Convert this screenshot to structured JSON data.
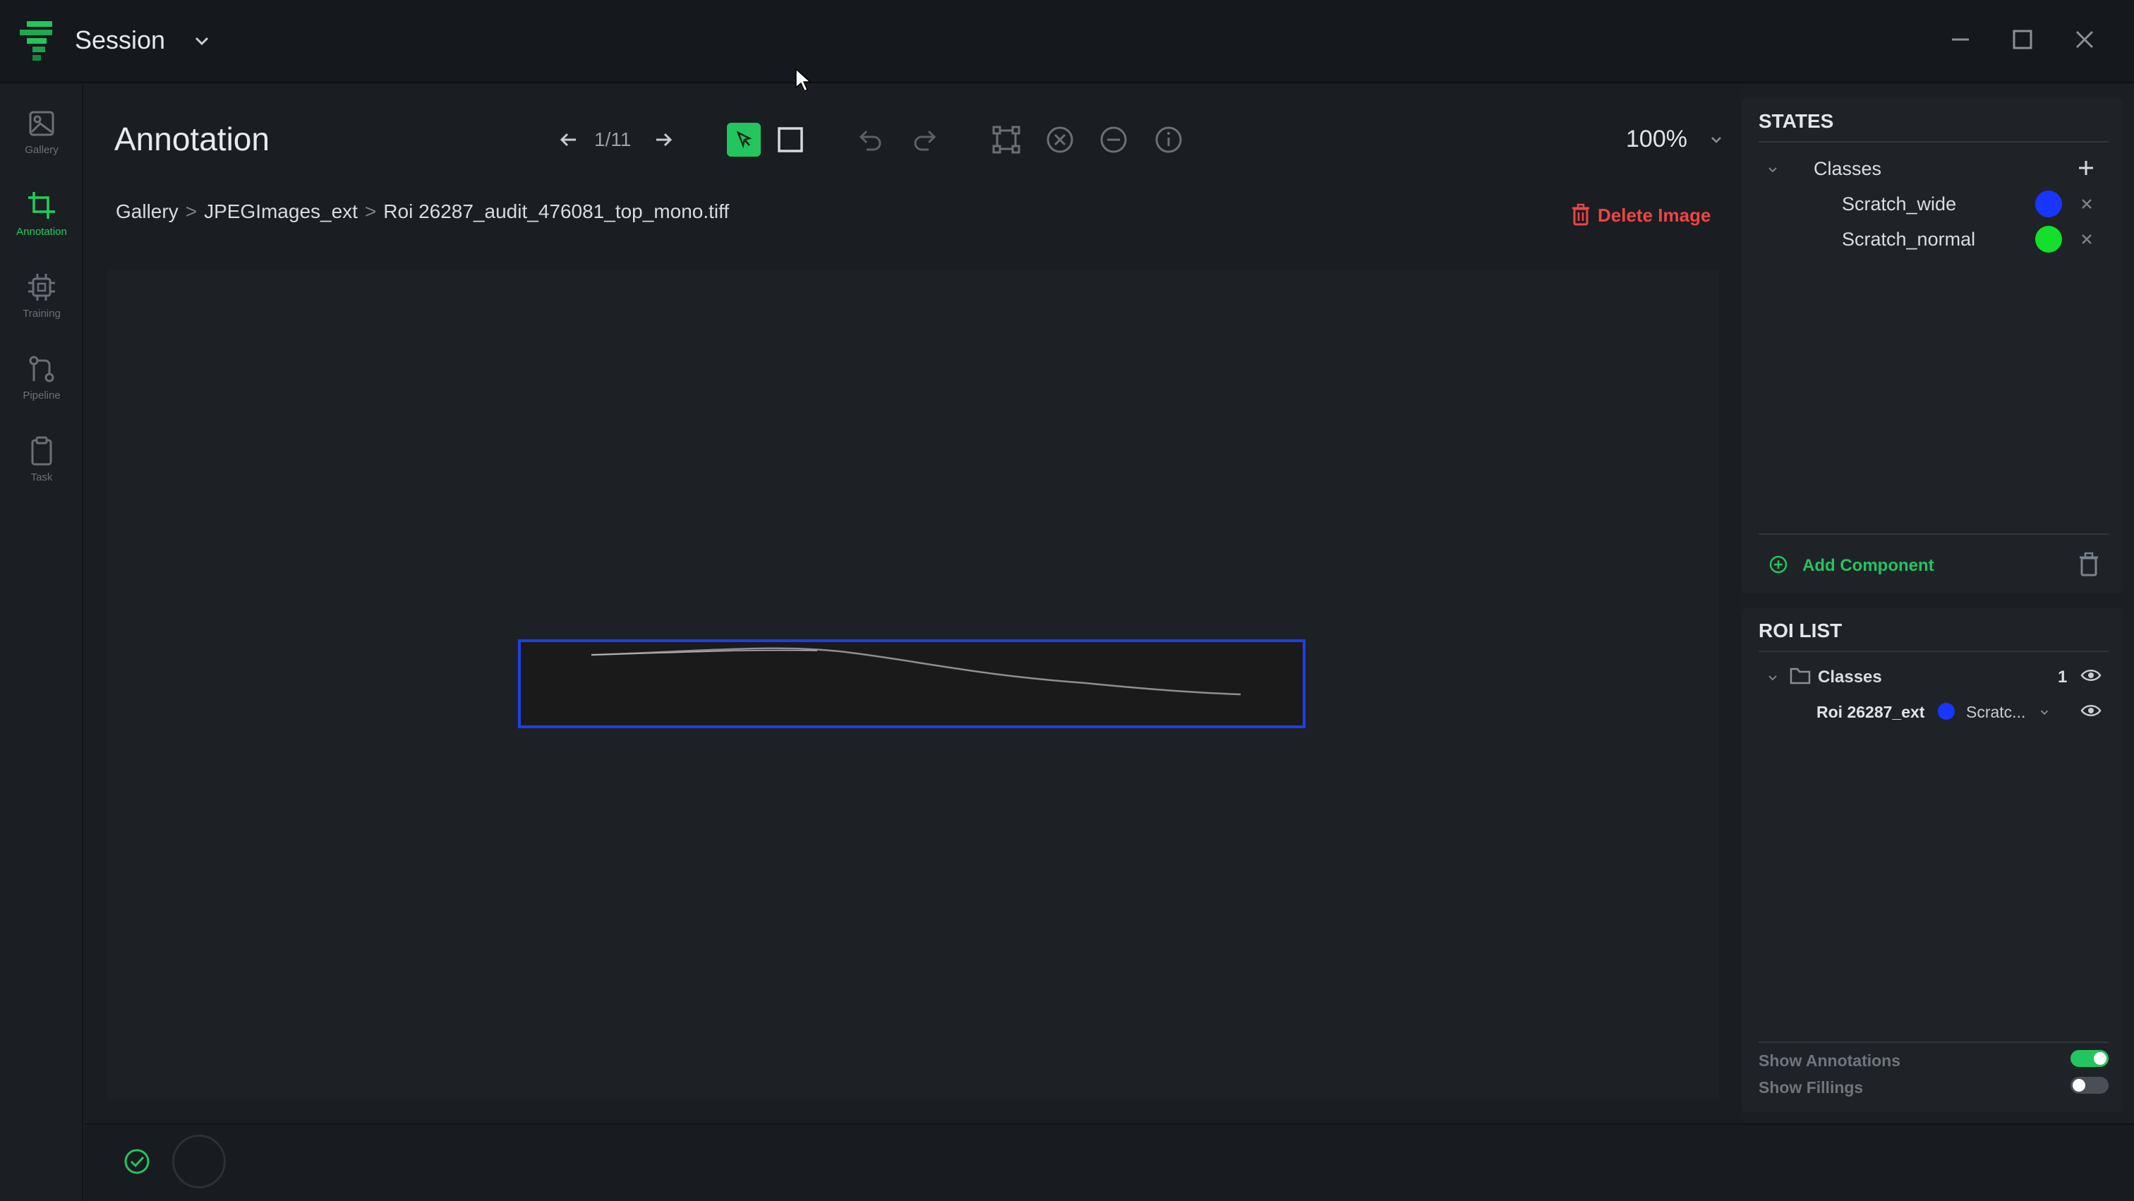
{
  "window": {
    "title": "Session"
  },
  "nav": [
    {
      "label": "Gallery",
      "icon": "image-icon",
      "active": false
    },
    {
      "label": "Annotation",
      "icon": "crop-icon",
      "active": true
    },
    {
      "label": "Training",
      "icon": "chip-icon",
      "active": false
    },
    {
      "label": "Pipeline",
      "icon": "pipeline-icon",
      "active": false
    },
    {
      "label": "Task",
      "icon": "clipboard-icon",
      "active": false
    }
  ],
  "toolbar": {
    "title": "Annotation",
    "page_counter": "1/11",
    "zoom": "100%"
  },
  "breadcrumb": {
    "items": [
      "Gallery",
      "JPEGImages_ext",
      "Roi 26287_audit_476081_top_mono.tiff"
    ],
    "separator": ">"
  },
  "delete_image_label": "Delete Image",
  "states": {
    "title": "STATES",
    "group_label": "Classes",
    "classes": [
      {
        "name": "Scratch_wide",
        "color": "#1736ff"
      },
      {
        "name": "Scratch_normal",
        "color": "#12e02a"
      }
    ],
    "add_component_label": "Add Component"
  },
  "roi_list": {
    "title": "ROI LIST",
    "group_label": "Classes",
    "count": "1",
    "items": [
      {
        "name": "Roi 26287_ext",
        "class_label": "Scratc...",
        "color": "#1736ff"
      }
    ]
  },
  "toggles": {
    "show_annotations_label": "Show Annotations",
    "show_annotations": true,
    "show_fillings_label": "Show Fillings",
    "show_fillings": false
  },
  "colors": {
    "accent": "#22c55e",
    "danger": "#ef4444",
    "roi_border": "#1d3fe6"
  }
}
